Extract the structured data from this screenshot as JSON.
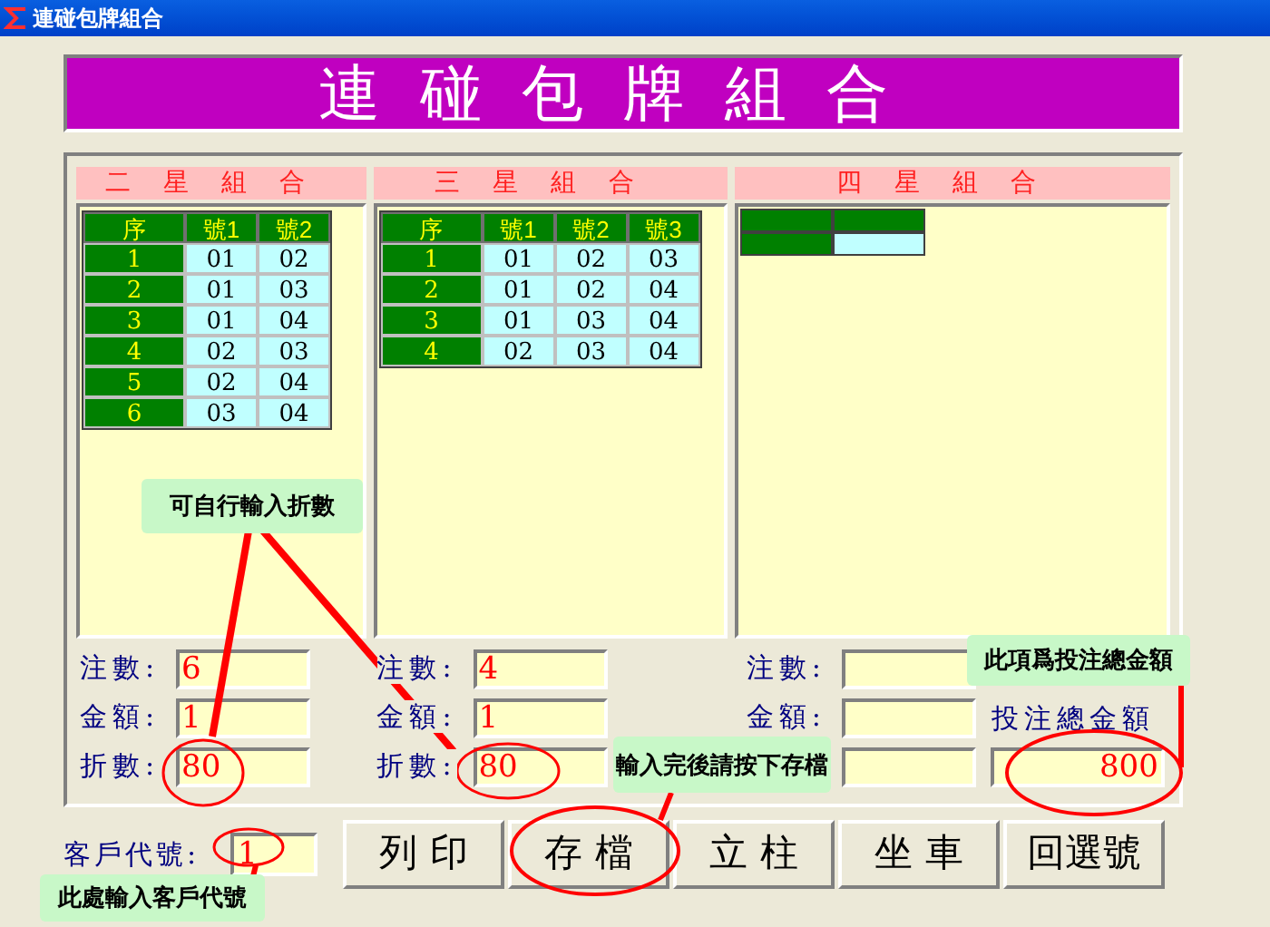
{
  "window": {
    "title": "連碰包牌組合"
  },
  "banner": {
    "title": "連碰包牌組合"
  },
  "sections": [
    {
      "title": "二星組合",
      "kind": "table",
      "columns": [
        "序",
        "號1",
        "號2"
      ],
      "rows": [
        [
          "1",
          "01",
          "02"
        ],
        [
          "2",
          "01",
          "03"
        ],
        [
          "3",
          "01",
          "04"
        ],
        [
          "4",
          "02",
          "03"
        ],
        [
          "5",
          "02",
          "04"
        ],
        [
          "6",
          "03",
          "04"
        ]
      ],
      "fields": [
        {
          "label": "注數:",
          "value": "6"
        },
        {
          "label": "金額:",
          "value": "1"
        },
        {
          "label": "折數:",
          "value": "80"
        }
      ]
    },
    {
      "title": "三星組合",
      "kind": "table",
      "columns": [
        "序",
        "號1",
        "號2",
        "號3"
      ],
      "rows": [
        [
          "1",
          "01",
          "02",
          "03"
        ],
        [
          "2",
          "01",
          "02",
          "04"
        ],
        [
          "3",
          "01",
          "03",
          "04"
        ],
        [
          "4",
          "02",
          "03",
          "04"
        ]
      ],
      "fields": [
        {
          "label": "注數:",
          "value": "4"
        },
        {
          "label": "金額:",
          "value": "1"
        },
        {
          "label": "折數:",
          "value": "80"
        }
      ]
    },
    {
      "title": "四星組合",
      "kind": "empty",
      "fields": [
        {
          "label": "注數:"
        },
        {
          "label": "金額:"
        }
      ],
      "total": {
        "label": "投注總金額",
        "value": "800"
      }
    }
  ],
  "customer": {
    "label": "客戶代號:",
    "value": "1"
  },
  "buttons": [
    "列 印",
    "存 檔",
    "立 柱",
    "坐 車",
    "回選號"
  ],
  "callouts": [
    {
      "text": "可自行輸入折數"
    },
    {
      "text": "輸入完後請按下存檔"
    },
    {
      "text": "此項爲投注總金額"
    },
    {
      "text": "此處輸入客戶代號"
    }
  ]
}
